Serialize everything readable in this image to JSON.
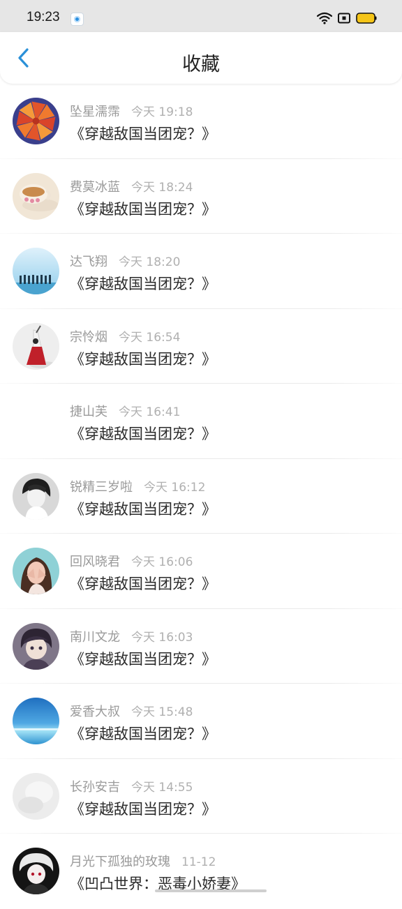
{
  "status_bar": {
    "time": "19:23",
    "battery_color": "#f5c518"
  },
  "header": {
    "title": "收藏",
    "back_icon": "chevron-left-icon",
    "accent": "#2a90d8"
  },
  "favorites": [
    {
      "name": "坠星濡霈",
      "time": "今天 19:18",
      "book": "《穿越敌国当团宠？》",
      "avatar": "pinwheel"
    },
    {
      "name": "费莫冰蓝",
      "time": "今天 18:24",
      "book": "《穿越敌国当团宠？》",
      "avatar": "teacup"
    },
    {
      "name": "达飞翔",
      "time": "今天 18:20",
      "book": "《穿越敌国当团宠？》",
      "avatar": "beach-group"
    },
    {
      "name": "宗怜烟",
      "time": "今天 16:54",
      "book": "《穿越敌国当团宠？》",
      "avatar": "girl-red-dress"
    },
    {
      "name": "捷山芙",
      "time": "今天 16:41",
      "book": "《穿越敌国当团宠？》",
      "avatar": "none"
    },
    {
      "name": "锐精三岁啦",
      "time": "今天 16:12",
      "book": "《穿越敌国当团宠？》",
      "avatar": "bw-portrait"
    },
    {
      "name": "回风晓君",
      "time": "今天 16:06",
      "book": "《穿越敌国当团宠？》",
      "avatar": "girl-hands-face"
    },
    {
      "name": "南川文龙",
      "time": "今天 16:03",
      "book": "《穿越敌国当团宠？》",
      "avatar": "anime-boy"
    },
    {
      "name": "爱香大叔",
      "time": "今天 15:48",
      "book": "《穿越敌国当团宠？》",
      "avatar": "ocean"
    },
    {
      "name": "长孙安吉",
      "time": "今天 14:55",
      "book": "《穿越敌国当团宠？》",
      "avatar": "white-blur"
    },
    {
      "name": "月光下孤独的玫瑰",
      "time": "11-12",
      "book": "《凹凸世界：恶毒小娇妻》",
      "avatar": "dark-anime"
    }
  ]
}
